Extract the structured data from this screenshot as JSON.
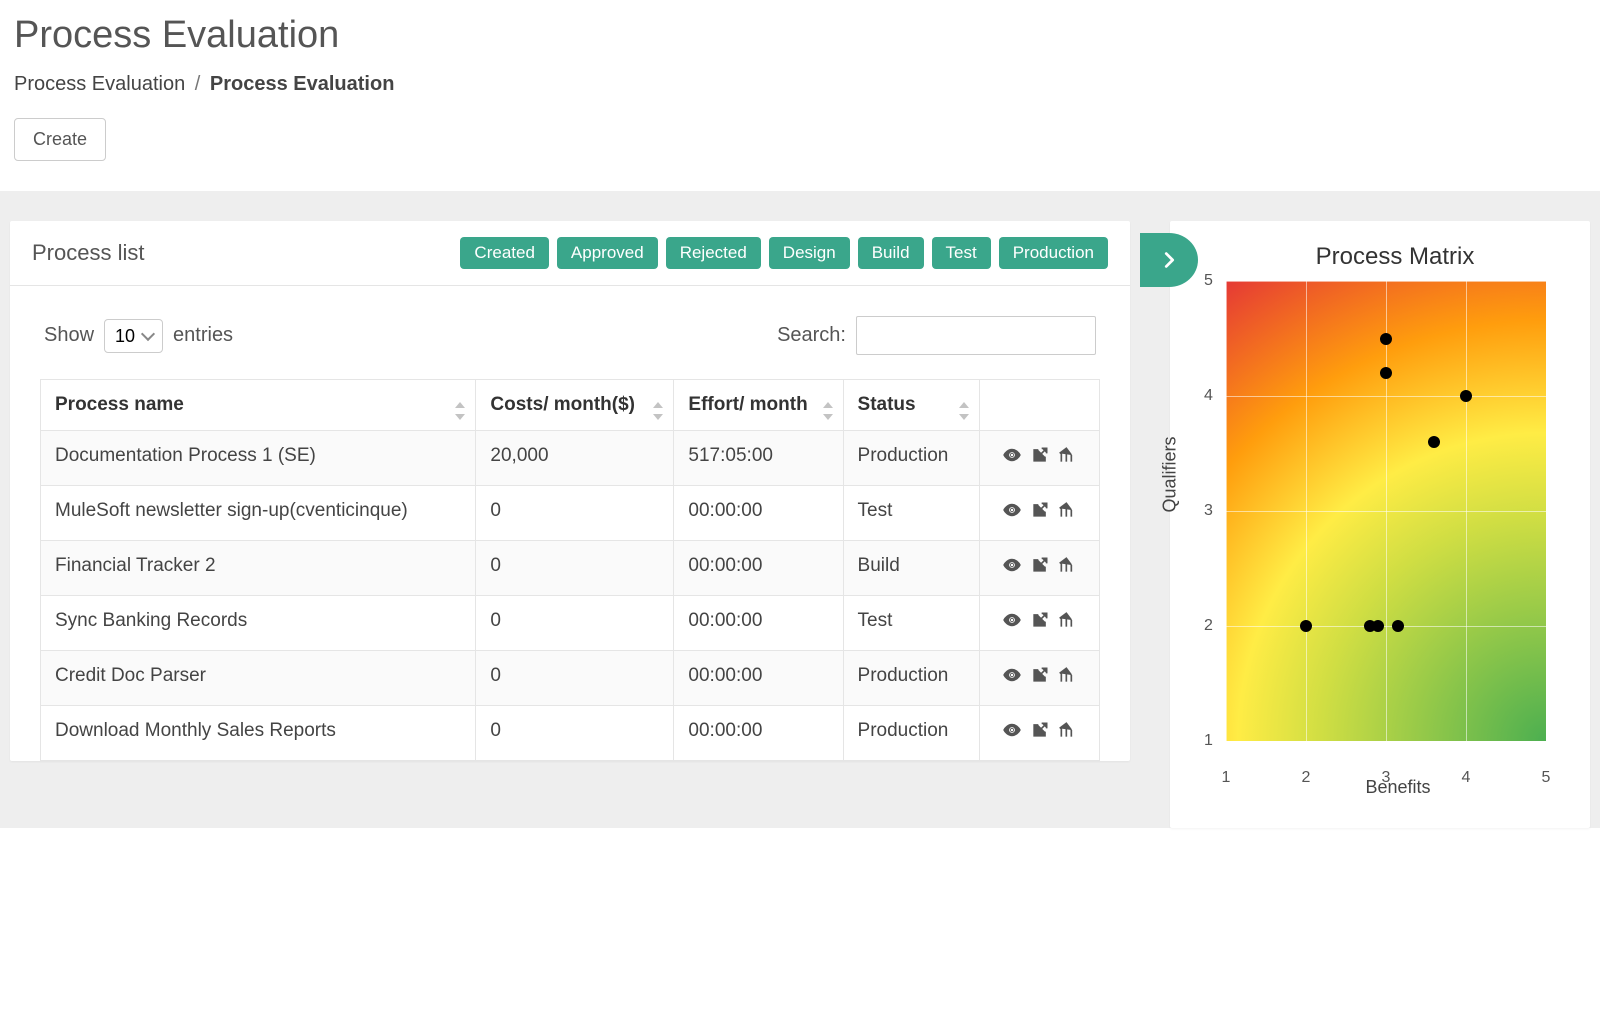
{
  "page": {
    "title": "Process Evaluation",
    "breadcrumb_root": "Process Evaluation",
    "breadcrumb_current": "Process Evaluation",
    "create_label": "Create"
  },
  "list_panel": {
    "title": "Process list",
    "show_label": "Show",
    "entries_label": "entries",
    "search_label": "Search:",
    "page_size": "10",
    "columns": {
      "name": "Process name",
      "cost": "Costs/ month($)",
      "effort": "Effort/ month",
      "status": "Status"
    },
    "status_filters": [
      "Created",
      "Approved",
      "Rejected",
      "Design",
      "Build",
      "Test",
      "Production"
    ],
    "rows": [
      {
        "name": "Documentation Process 1 (SE)",
        "cost": "20,000",
        "effort": "517:05:00",
        "status": "Production"
      },
      {
        "name": "MuleSoft newsletter sign-up(cventicinque)",
        "cost": "0",
        "effort": "00:00:00",
        "status": "Test"
      },
      {
        "name": "Financial Tracker 2",
        "cost": "0",
        "effort": "00:00:00",
        "status": "Build"
      },
      {
        "name": "Sync Banking Records",
        "cost": "0",
        "effort": "00:00:00",
        "status": "Test"
      },
      {
        "name": "Credit Doc Parser",
        "cost": "0",
        "effort": "00:00:00",
        "status": "Production"
      },
      {
        "name": "Download Monthly Sales Reports",
        "cost": "0",
        "effort": "00:00:00",
        "status": "Production"
      }
    ]
  },
  "matrix_panel": {
    "title": "Process Matrix",
    "x_label": "Benefits",
    "y_label": "Qualifiers"
  },
  "chart_data": {
    "type": "scatter",
    "title": "Process Matrix",
    "xlabel": "Benefits",
    "ylabel": "Qualifiers",
    "xlim": [
      1,
      5
    ],
    "ylim": [
      1,
      5
    ],
    "x_ticks": [
      1,
      2,
      3,
      4,
      5
    ],
    "y_ticks": [
      1,
      2,
      3,
      4,
      5
    ],
    "points": [
      {
        "x": 3.0,
        "y": 4.5
      },
      {
        "x": 3.0,
        "y": 4.2
      },
      {
        "x": 4.0,
        "y": 4.0
      },
      {
        "x": 3.6,
        "y": 3.6
      },
      {
        "x": 2.0,
        "y": 2.0
      },
      {
        "x": 2.8,
        "y": 2.0
      },
      {
        "x": 2.9,
        "y": 2.0
      },
      {
        "x": 3.15,
        "y": 2.0
      }
    ]
  }
}
